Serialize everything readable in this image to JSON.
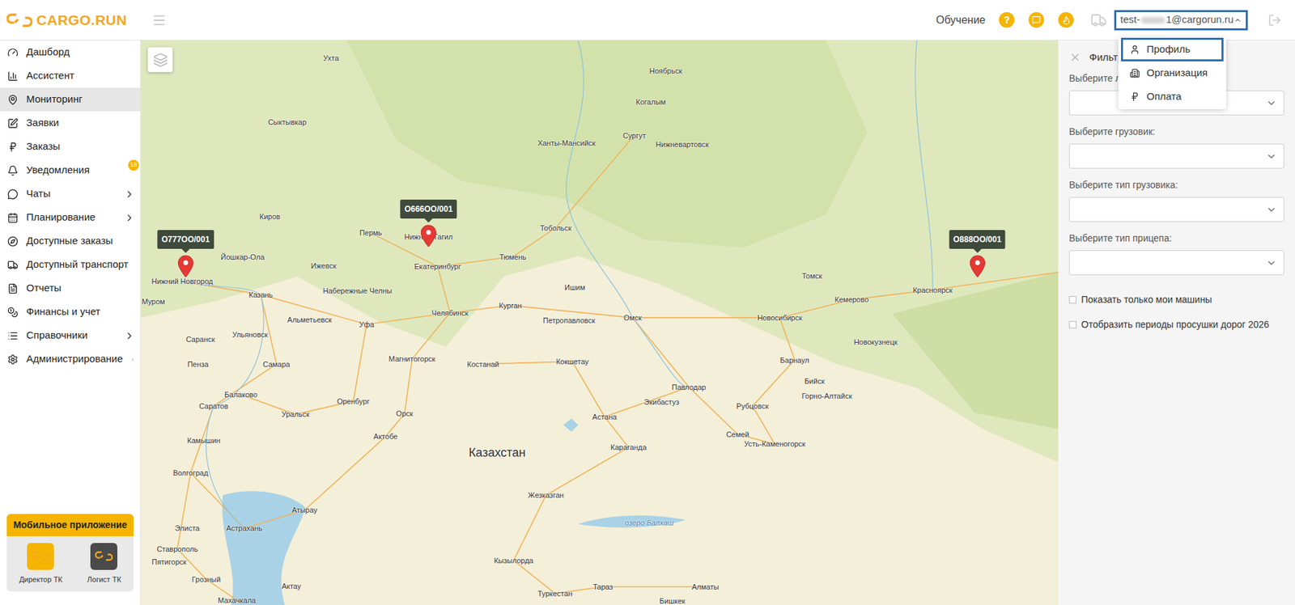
{
  "header": {
    "logo": "CARGO.RUN",
    "training": "Обучение",
    "user": {
      "email_start": "test-",
      "email_end": "1@cargorun.ru",
      "menu_open": true
    }
  },
  "user_menu": [
    {
      "label": "Профиль",
      "selected": true
    },
    {
      "label": "Организация",
      "selected": false
    },
    {
      "label": "Оплата",
      "selected": false
    }
  ],
  "sidebar": {
    "items": [
      {
        "label": "Дашборд",
        "selected": false,
        "has_submenu": false,
        "badge": ""
      },
      {
        "label": "Ассистент",
        "selected": false,
        "has_submenu": false,
        "badge": ""
      },
      {
        "label": "Мониторинг",
        "selected": true,
        "has_submenu": false,
        "badge": ""
      },
      {
        "label": "Заявки",
        "selected": false,
        "has_submenu": false,
        "badge": ""
      },
      {
        "label": "Заказы",
        "selected": false,
        "has_submenu": false,
        "badge": ""
      },
      {
        "label": "Уведомления",
        "selected": false,
        "has_submenu": false,
        "badge": "18"
      },
      {
        "label": "Чаты",
        "selected": false,
        "has_submenu": true,
        "badge": ""
      },
      {
        "label": "Планирование",
        "selected": false,
        "has_submenu": true,
        "badge": ""
      },
      {
        "label": "Доступные заказы",
        "selected": false,
        "has_submenu": false,
        "badge": ""
      },
      {
        "label": "Доступный транспорт",
        "selected": false,
        "has_submenu": false,
        "badge": ""
      },
      {
        "label": "Отчеты",
        "selected": false,
        "has_submenu": false,
        "badge": ""
      },
      {
        "label": "Финансы и учет",
        "selected": false,
        "has_submenu": false,
        "badge": ""
      },
      {
        "label": "Справочники",
        "selected": false,
        "has_submenu": true,
        "badge": ""
      },
      {
        "label": "Администрирование",
        "selected": false,
        "has_submenu": true,
        "badge": ""
      }
    ],
    "mobile_app": {
      "title": "Мобильное приложение",
      "apps": [
        {
          "label": "Директор ТК",
          "color": "#f5b400"
        },
        {
          "label": "Логист ТК",
          "color": "#4a4a4a"
        }
      ]
    }
  },
  "map": {
    "vehicles": [
      {
        "plate": "О777ОО/001"
      },
      {
        "plate": "О666ОО/001"
      },
      {
        "plate": "О888ОО/001"
      }
    ],
    "labels": [
      {
        "text": "Ухта",
        "kind": "city"
      },
      {
        "text": "Ноябрьск",
        "kind": "city"
      },
      {
        "text": "Когалым",
        "kind": "city"
      },
      {
        "text": "Сыктывкар",
        "kind": "city"
      },
      {
        "text": "Ханты-Мансийск",
        "kind": "city"
      },
      {
        "text": "Сургут",
        "kind": "city"
      },
      {
        "text": "Нижневартовск",
        "kind": "city"
      },
      {
        "text": "Киров",
        "kind": "city"
      },
      {
        "text": "Пермь",
        "kind": "city"
      },
      {
        "text": "Нижний Тагил",
        "kind": "city"
      },
      {
        "text": "Тобольск",
        "kind": "city"
      },
      {
        "text": "Йошкар-Ола",
        "kind": "city"
      },
      {
        "text": "Екатеринбург",
        "kind": "city"
      },
      {
        "text": "Тюмень",
        "kind": "city"
      },
      {
        "text": "Нижний Новгород",
        "kind": "city"
      },
      {
        "text": "Ижевск",
        "kind": "city"
      },
      {
        "text": "Казань",
        "kind": "city"
      },
      {
        "text": "Набережные Челны",
        "kind": "city"
      },
      {
        "text": "Томск",
        "kind": "city"
      },
      {
        "text": "Кемерово",
        "kind": "city"
      },
      {
        "text": "Красноярск",
        "kind": "city"
      },
      {
        "text": "Муром",
        "kind": "city"
      },
      {
        "text": "Ишим",
        "kind": "city"
      },
      {
        "text": "Альметьевск",
        "kind": "city"
      },
      {
        "text": "Челябинск",
        "kind": "city"
      },
      {
        "text": "Курган",
        "kind": "city"
      },
      {
        "text": "Петропавловск",
        "kind": "city"
      },
      {
        "text": "Омск",
        "kind": "city"
      },
      {
        "text": "Новосибирск",
        "kind": "city"
      },
      {
        "text": "Новокузнецк",
        "kind": "city"
      },
      {
        "text": "Уфа",
        "kind": "city"
      },
      {
        "text": "Ульяновск",
        "kind": "city"
      },
      {
        "text": "Саранск",
        "kind": "city"
      },
      {
        "text": "Барнаул",
        "kind": "city"
      },
      {
        "text": "Магнитогорск",
        "kind": "city"
      },
      {
        "text": "Костанай",
        "kind": "city"
      },
      {
        "text": "Кокшетау",
        "kind": "city"
      },
      {
        "text": "Пенза",
        "kind": "city"
      },
      {
        "text": "Самара",
        "kind": "city"
      },
      {
        "text": "Бийск",
        "kind": "city"
      },
      {
        "text": "Горно-Алтайск",
        "kind": "city"
      },
      {
        "text": "Павлодар",
        "kind": "city"
      },
      {
        "text": "Рубцовск",
        "kind": "city"
      },
      {
        "text": "Балаково",
        "kind": "city"
      },
      {
        "text": "Саратов",
        "kind": "city"
      },
      {
        "text": "Оренбург",
        "kind": "city"
      },
      {
        "text": "Экибастуз",
        "kind": "city"
      },
      {
        "text": "Уральск",
        "kind": "city"
      },
      {
        "text": "Орск",
        "kind": "city"
      },
      {
        "text": "Астана",
        "kind": "city"
      },
      {
        "text": "Актобе",
        "kind": "city"
      },
      {
        "text": "Камышин",
        "kind": "city"
      },
      {
        "text": "Семей",
        "kind": "city"
      },
      {
        "text": "Усть-Каменогорск",
        "kind": "city"
      },
      {
        "text": "Казахстан",
        "kind": "country"
      },
      {
        "text": "Караганда",
        "kind": "city"
      },
      {
        "text": "Волгоград",
        "kind": "city"
      },
      {
        "text": "Жезказган",
        "kind": "city"
      },
      {
        "text": "Элиста",
        "kind": "city"
      },
      {
        "text": "Астрахань",
        "kind": "city"
      },
      {
        "text": "Атырау",
        "kind": "city"
      },
      {
        "text": "Ставрополь",
        "kind": "city"
      },
      {
        "text": "Пятигорск",
        "kind": "city"
      },
      {
        "text": "Грозный",
        "kind": "city"
      },
      {
        "text": "Кызылорда",
        "kind": "city"
      },
      {
        "text": "Актау",
        "kind": "city"
      },
      {
        "text": "Махачкала",
        "kind": "city"
      },
      {
        "text": "озеро Балхаш",
        "kind": "water"
      },
      {
        "text": "Туркестан",
        "kind": "city"
      },
      {
        "text": "Тараз",
        "kind": "city"
      },
      {
        "text": "Алматы",
        "kind": "city"
      },
      {
        "text": "Бишкек",
        "kind": "city"
      }
    ]
  },
  "filters": {
    "title": "Фильтр",
    "selects": [
      {
        "label": "Выберите л",
        "value": ""
      },
      {
        "label": "Выберите грузовик:",
        "value": ""
      },
      {
        "label": "Выберите тип грузовика:",
        "value": ""
      },
      {
        "label": "Выберите тип прицепа:",
        "value": ""
      }
    ],
    "checkboxes": [
      {
        "label": "Показать только мои машины",
        "checked": false
      },
      {
        "label": "Отобразить периоды просушки дорог 2026",
        "checked": false
      }
    ]
  }
}
